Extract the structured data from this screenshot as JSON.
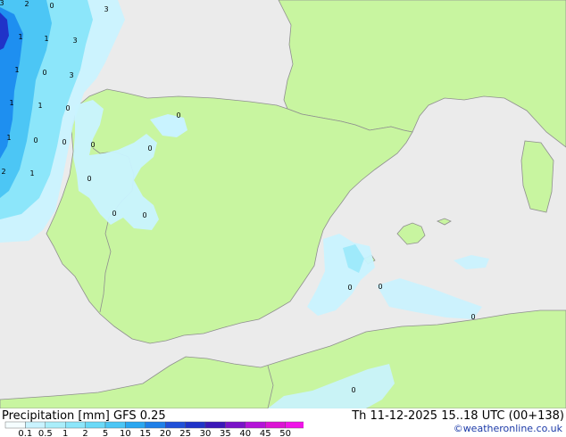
{
  "map": {
    "colors": {
      "sea": "#ebebeb",
      "land": "#c8f5a0",
      "border": "#8f8f8f",
      "precip_light": "#c9f3ff",
      "precip_mid": "#8ce6fa",
      "precip_heavy": "#4cc6f5",
      "precip_strong": "#1e8ff0",
      "precip_core": "#2033c8"
    },
    "point_labels": [
      "3",
      "2",
      "0",
      "3",
      "1",
      "1",
      "3",
      "1",
      "0",
      "3",
      "1",
      "1",
      "0",
      "1",
      "0",
      "0",
      "0",
      "2",
      "1",
      "0",
      "0",
      "0",
      "0",
      "0",
      "0",
      "0",
      "0",
      "0"
    ]
  },
  "footer": {
    "title_left": "Precipitation [mm]  GFS 0.25",
    "title_right": "Th 11-12-2025 15..18 UTC (00+138)",
    "credit": "©weatheronline.co.uk"
  },
  "legend": {
    "ticks": [
      "0.1",
      "0.5",
      "1",
      "2",
      "5",
      "10",
      "15",
      "20",
      "25",
      "30",
      "35",
      "40",
      "45",
      "50"
    ],
    "colors": [
      "#f5fdff",
      "#c9f3ff",
      "#aaeefa",
      "#8ce6fa",
      "#6ad9f7",
      "#4cc6f5",
      "#2aa6f0",
      "#1e7fe8",
      "#2050d8",
      "#2033c8",
      "#3b18b8",
      "#7a14c8",
      "#b414d8",
      "#dc14d4",
      "#f014e8"
    ]
  }
}
